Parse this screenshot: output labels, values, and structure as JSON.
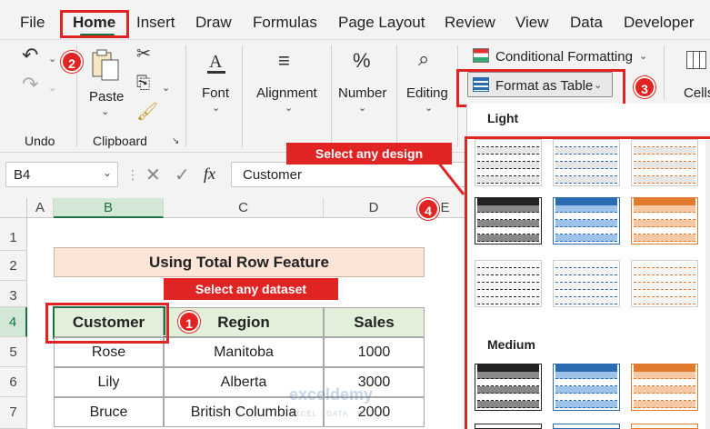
{
  "menu": [
    "File",
    "Home",
    "Insert",
    "Draw",
    "Formulas",
    "Page Layout",
    "Review",
    "View",
    "Data",
    "Developer"
  ],
  "ribbon": {
    "undo_label": "Undo",
    "paste_label": "Paste",
    "clipboard_label": "Clipboard",
    "font_label": "Font",
    "alignment_label": "Alignment",
    "number_label": "Number",
    "editing_label": "Editing",
    "conditional_formatting": "Conditional Formatting",
    "format_as_table": "Format as Table",
    "cells_label": "Cells",
    "number_icon": "%"
  },
  "formula_bar": {
    "name_box": "B4",
    "fx": "fx",
    "content": "Customer"
  },
  "columns": [
    "A",
    "B",
    "C",
    "D",
    "E"
  ],
  "rows": [
    "1",
    "2",
    "3",
    "4",
    "5",
    "6",
    "7"
  ],
  "sheet": {
    "title": "Using Total Row Feature",
    "headers": [
      "Customer",
      "Region",
      "Sales"
    ],
    "data": [
      [
        "Rose",
        "Manitoba",
        "1000"
      ],
      [
        "Lily",
        "Alberta",
        "3000"
      ],
      [
        "Bruce",
        "British Columbia",
        "2000"
      ]
    ]
  },
  "gallery": {
    "light_label": "Light",
    "medium_label": "Medium"
  },
  "annotations": {
    "select_design": "Select any design",
    "select_dataset": "Select any dataset",
    "step1": "1",
    "step2": "2",
    "step3": "3",
    "step4": "4"
  },
  "watermark": "exceldemy",
  "watermark_sub": "EXCEL · DATA · BI",
  "colors": {
    "accent": "#1e7145",
    "annotation": "#e02424",
    "title_fill": "#fce4d6",
    "header_fill": "#e2efda"
  }
}
